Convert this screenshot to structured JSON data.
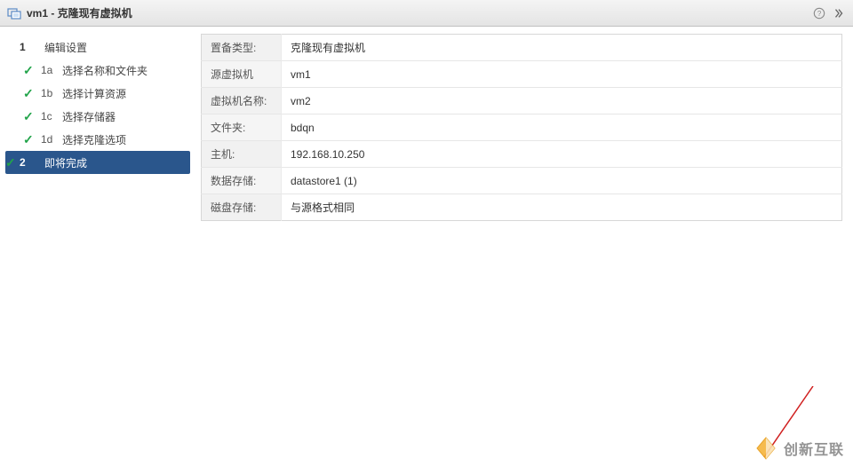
{
  "titlebar": {
    "title": "vm1 - 克隆现有虚拟机"
  },
  "sidebar": {
    "steps": [
      {
        "num": "1",
        "label": "编辑设置",
        "type": "top",
        "completed": false
      },
      {
        "num": "1a",
        "label": "选择名称和文件夹",
        "type": "sub",
        "completed": true
      },
      {
        "num": "1b",
        "label": "选择计算资源",
        "type": "sub",
        "completed": true
      },
      {
        "num": "1c",
        "label": "选择存储器",
        "type": "sub",
        "completed": true
      },
      {
        "num": "1d",
        "label": "选择克隆选项",
        "type": "sub",
        "completed": true
      },
      {
        "num": "2",
        "label": "即将完成",
        "type": "top",
        "completed": false,
        "active": true
      }
    ]
  },
  "summary": {
    "rows": [
      {
        "key": "置备类型:",
        "value": "克隆现有虚拟机"
      },
      {
        "key": "源虚拟机",
        "value": "vm1"
      },
      {
        "key": "虚拟机名称:",
        "value": "vm2"
      },
      {
        "key": "文件夹:",
        "value": "bdqn"
      },
      {
        "key": "主机:",
        "value": "192.168.10.250"
      },
      {
        "key": "数据存储:",
        "value": "datastore1 (1)"
      },
      {
        "key": "磁盘存储:",
        "value": "与源格式相同"
      }
    ]
  },
  "watermark": {
    "text": "创新互联"
  }
}
